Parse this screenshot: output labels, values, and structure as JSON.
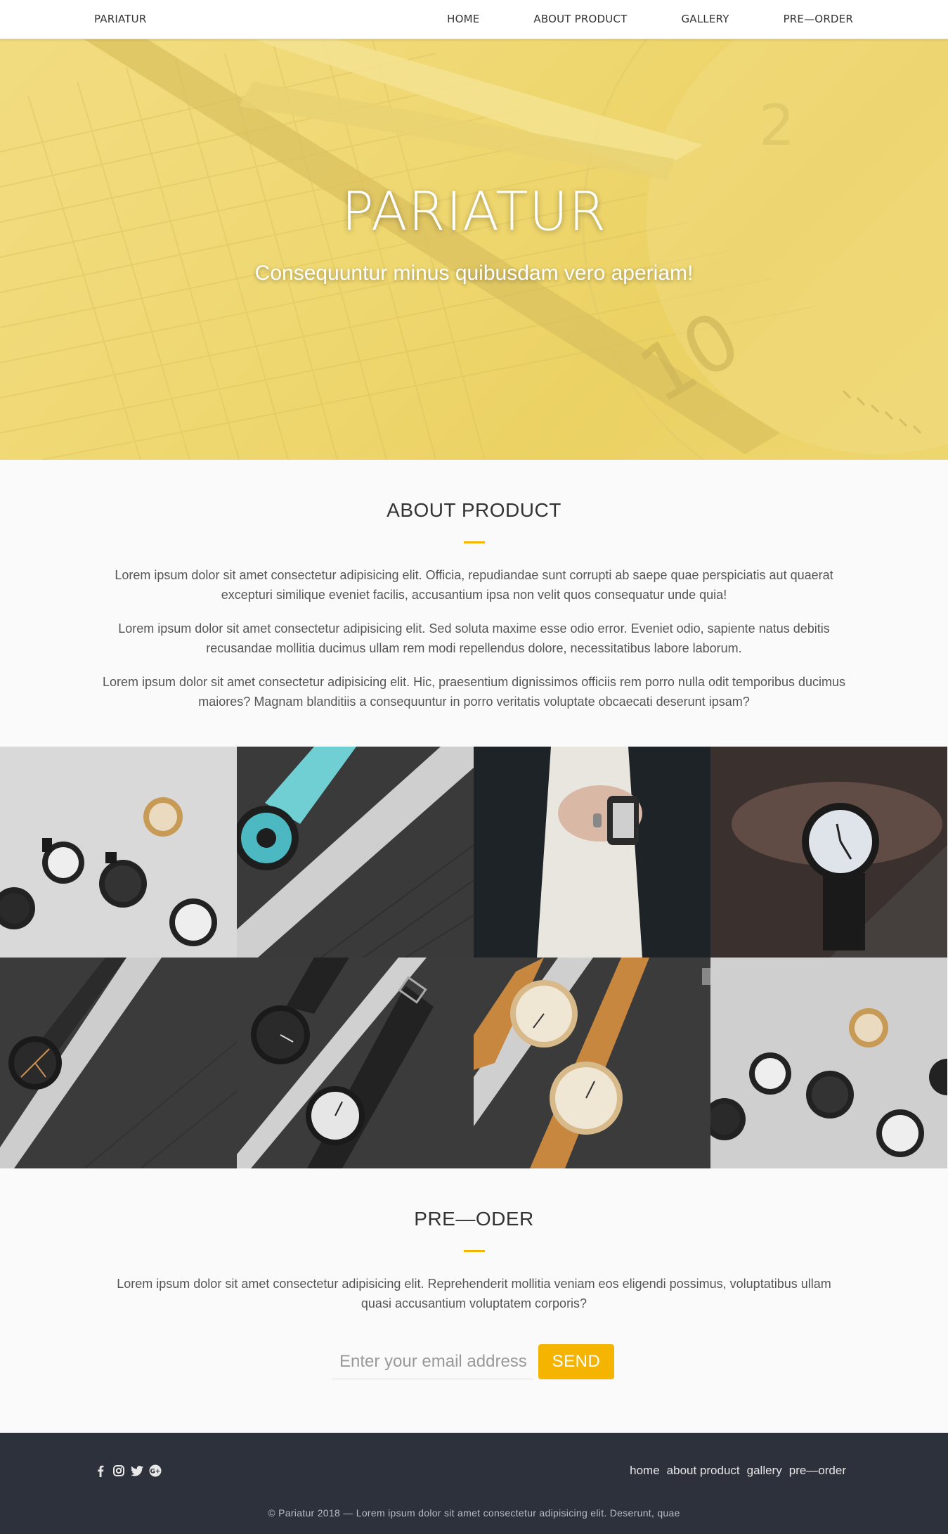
{
  "nav": {
    "brand": "PARIATUR",
    "links": [
      "HOME",
      "ABOUT PRODUCT",
      "GALLERY",
      "PRE—ORDER"
    ]
  },
  "hero": {
    "title": "PARIATUR",
    "subtitle": "Consequuntur minus quibusdam vero aperiam!"
  },
  "about": {
    "title": "ABOUT PRODUCT",
    "paragraphs": [
      "Lorem ipsum dolor sit amet consectetur adipisicing elit. Officia, repudiandae sunt corrupti ab saepe quae perspiciatis aut quaerat excepturi similique eveniet facilis, accusantium ipsa non velit quos consequatur unde quia!",
      "Lorem ipsum dolor sit amet consectetur adipisicing elit. Sed soluta maxime esse odio error. Eveniet odio, sapiente natus debitis recusandae mollitia ducimus ullam rem modi repellendus dolore, necessitatibus labore laborum.",
      "Lorem ipsum dolor sit amet consectetur adipisicing elit. Hic, praesentium dignissimos officiis rem porro nulla odit temporibus ducimus maiores? Magnam blanditiis a consequuntur in porro veritatis voluptate obcaecati deserunt ipsam?"
    ]
  },
  "gallery": {
    "images": [
      "watch-photo-1",
      "watch-photo-2",
      "watch-photo-3",
      "watch-photo-4",
      "watch-photo-5",
      "watch-photo-6",
      "watch-photo-7",
      "watch-photo-8"
    ]
  },
  "preorder": {
    "title": "PRE—ODER",
    "text": "Lorem ipsum dolor sit amet consectetur adipisicing elit. Reprehenderit mollitia veniam eos eligendi possimus, voluptatibus ullam quasi accusantium voluptatem corporis?",
    "email_placeholder": "Enter your email address",
    "send_label": "SEND"
  },
  "footer": {
    "social_icons": [
      "facebook-icon",
      "instagram-icon",
      "twitter-icon",
      "google-plus-icon"
    ],
    "links": [
      "home",
      "about product",
      "gallery",
      "pre—order"
    ],
    "copyright": "© Pariatur 2018 — Lorem ipsum dolor sit amet consectetur adipisicing elit. Deserunt, quae"
  },
  "colors": {
    "accent": "#f4b400",
    "hero_tint": "#efd978",
    "footer_bg": "#2d313c"
  }
}
